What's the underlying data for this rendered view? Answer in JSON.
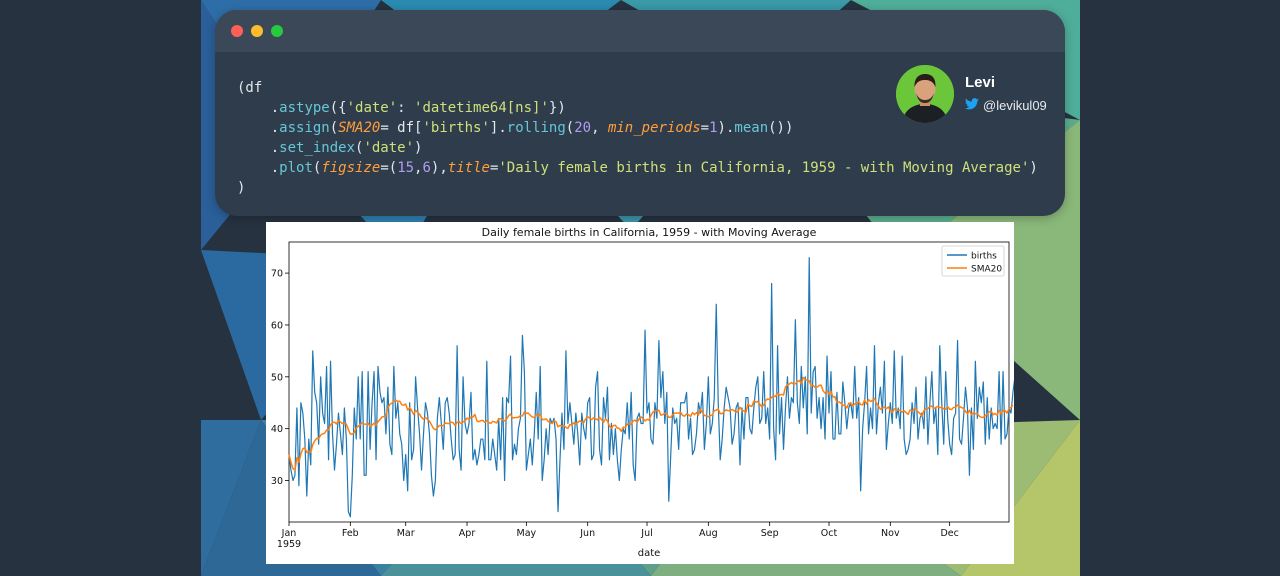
{
  "code": {
    "lines": [
      [
        {
          "t": "(df",
          "c": ""
        }
      ],
      [
        {
          "t": "    .",
          "c": ""
        },
        {
          "t": "astype",
          "c": "c-m"
        },
        {
          "t": "({",
          "c": ""
        },
        {
          "t": "'date'",
          "c": "c-s"
        },
        {
          "t": ": ",
          "c": ""
        },
        {
          "t": "'datetime64[ns]'",
          "c": "c-s"
        },
        {
          "t": "})",
          "c": ""
        }
      ],
      [
        {
          "t": "    .",
          "c": ""
        },
        {
          "t": "assign",
          "c": "c-m"
        },
        {
          "t": "(",
          "c": ""
        },
        {
          "t": "SMA20",
          "c": "c-k"
        },
        {
          "t": "= df[",
          "c": ""
        },
        {
          "t": "'births'",
          "c": "c-s"
        },
        {
          "t": "].",
          "c": ""
        },
        {
          "t": "rolling",
          "c": "c-m"
        },
        {
          "t": "(",
          "c": ""
        },
        {
          "t": "20",
          "c": "c-n"
        },
        {
          "t": ", ",
          "c": ""
        },
        {
          "t": "min_periods",
          "c": "c-k"
        },
        {
          "t": "=",
          "c": ""
        },
        {
          "t": "1",
          "c": "c-n"
        },
        {
          "t": ").",
          "c": ""
        },
        {
          "t": "mean",
          "c": "c-m"
        },
        {
          "t": "())",
          "c": ""
        }
      ],
      [
        {
          "t": "    .",
          "c": ""
        },
        {
          "t": "set_index",
          "c": "c-m"
        },
        {
          "t": "(",
          "c": ""
        },
        {
          "t": "'date'",
          "c": "c-s"
        },
        {
          "t": ")",
          "c": ""
        }
      ],
      [
        {
          "t": "    .",
          "c": ""
        },
        {
          "t": "plot",
          "c": "c-m"
        },
        {
          "t": "(",
          "c": ""
        },
        {
          "t": "figsize",
          "c": "c-k"
        },
        {
          "t": "=(",
          "c": ""
        },
        {
          "t": "15",
          "c": "c-n"
        },
        {
          "t": ",",
          "c": ""
        },
        {
          "t": "6",
          "c": "c-n"
        },
        {
          "t": "),",
          "c": ""
        },
        {
          "t": "title",
          "c": "c-k"
        },
        {
          "t": "=",
          "c": ""
        },
        {
          "t": "'Daily female births in California, 1959 - with Moving Average'",
          "c": "c-s"
        },
        {
          "t": ")",
          "c": ""
        }
      ],
      [
        {
          "t": ")",
          "c": ""
        }
      ]
    ]
  },
  "author": {
    "name": "Levi",
    "handle": "@levikul09",
    "icon": "twitter-bird-icon"
  },
  "window": {
    "buttons": [
      "close-dot",
      "minimize-dot",
      "maximize-dot"
    ]
  },
  "colors": {
    "births": "#1f77b4",
    "sma": "#ff7f0e",
    "twitter": "#1da1f2"
  },
  "chart_data": {
    "type": "line",
    "title": "Daily female births in California, 1959 - with Moving Average",
    "xlabel": "date",
    "ylabel": "",
    "ylim": [
      22,
      76
    ],
    "yticks": [
      30,
      40,
      50,
      60,
      70
    ],
    "xlim": [
      "1959-01-01",
      "1959-12-31"
    ],
    "xticks": [
      {
        "date": "1959-01-01",
        "label": "Jan",
        "sub": "1959"
      },
      {
        "date": "1959-02-01",
        "label": "Feb"
      },
      {
        "date": "1959-03-01",
        "label": "Mar"
      },
      {
        "date": "1959-04-01",
        "label": "Apr"
      },
      {
        "date": "1959-05-01",
        "label": "May"
      },
      {
        "date": "1959-06-01",
        "label": "Jun"
      },
      {
        "date": "1959-07-01",
        "label": "Jul"
      },
      {
        "date": "1959-08-01",
        "label": "Aug"
      },
      {
        "date": "1959-09-01",
        "label": "Sep"
      },
      {
        "date": "1959-10-01",
        "label": "Oct"
      },
      {
        "date": "1959-11-01",
        "label": "Nov"
      },
      {
        "date": "1959-12-01",
        "label": "Dec"
      }
    ],
    "legend": "top-right",
    "grid": false,
    "series": [
      {
        "name": "births",
        "color": "#1f77b4",
        "start_date": "1959-01-01",
        "values": [
          35,
          32,
          30,
          31,
          44,
          29,
          45,
          43,
          38,
          27,
          38,
          33,
          55,
          47,
          45,
          37,
          50,
          43,
          41,
          52,
          34,
          53,
          39,
          32,
          37,
          43,
          39,
          35,
          44,
          38,
          24,
          23,
          31,
          44,
          38,
          50,
          38,
          51,
          31,
          31,
          51,
          36,
          45,
          51,
          34,
          52,
          47,
          45,
          46,
          39,
          48,
          37,
          35,
          52,
          42,
          45,
          39,
          37,
          30,
          35,
          28,
          45,
          34,
          36,
          50,
          44,
          39,
          32,
          39,
          45,
          43,
          39,
          31,
          27,
          30,
          42,
          46,
          41,
          36,
          45,
          46,
          43,
          38,
          34,
          35,
          56,
          36,
          32,
          50,
          41,
          39,
          41,
          47,
          34,
          36,
          33,
          35,
          38,
          38,
          34,
          53,
          34,
          34,
          38,
          35,
          32,
          42,
          34,
          46,
          30,
          46,
          45,
          54,
          34,
          37,
          35,
          40,
          42,
          58,
          51,
          32,
          35,
          38,
          33,
          39,
          47,
          38,
          52,
          30,
          34,
          40,
          35,
          42,
          41,
          42,
          38,
          24,
          34,
          43,
          36,
          55,
          41,
          45,
          41,
          37,
          43,
          39,
          33,
          43,
          40,
          38,
          45,
          46,
          34,
          35,
          48,
          51,
          36,
          33,
          46,
          42,
          48,
          34,
          41,
          35,
          40,
          34,
          30,
          36,
          40,
          39,
          45,
          38,
          47,
          33,
          30,
          42,
          43,
          41,
          41,
          59,
          43,
          45,
          38,
          37,
          45,
          42,
          57,
          46,
          51,
          41,
          47,
          26,
          35,
          44,
          41,
          42,
          36,
          45,
          45,
          45,
          47,
          38,
          42,
          35,
          36,
          39,
          45,
          43,
          47,
          36,
          41,
          50,
          39,
          41,
          46,
          64,
          45,
          34,
          38,
          44,
          48,
          46,
          44,
          37,
          39,
          44,
          45,
          33,
          44,
          38,
          46,
          46,
          40,
          39,
          44,
          48,
          50,
          41,
          42,
          51,
          41,
          44,
          38,
          68,
          40,
          34,
          56,
          39,
          46,
          36,
          44,
          50,
          42,
          46,
          45,
          61,
          45,
          41,
          52,
          44,
          50,
          39,
          73,
          43,
          51,
          52,
          42,
          46,
          40,
          46,
          38,
          54,
          43,
          51,
          38,
          38,
          47,
          39,
          39,
          49,
          45,
          40,
          44,
          45,
          42,
          52,
          42,
          46,
          28,
          40,
          45,
          52,
          39,
          44,
          40,
          56,
          39,
          45,
          48,
          43,
          53,
          36,
          41,
          45,
          41,
          55,
          42,
          44,
          40,
          54,
          38,
          35,
          36,
          38,
          45,
          41,
          48,
          38,
          42,
          43,
          40,
          50,
          37,
          45,
          51,
          41,
          44,
          35,
          56,
          45,
          37,
          51,
          42,
          37,
          35,
          42,
          43,
          57,
          38,
          37,
          42,
          48,
          44,
          31,
          44,
          36,
          53,
          42,
          48,
          45,
          49,
          37,
          46,
          38,
          44,
          40,
          41,
          40,
          51,
          37,
          51,
          38,
          39,
          44,
          43,
          47,
          50,
          49,
          34,
          52,
          41,
          55,
          37,
          42,
          53
        ]
      },
      {
        "name": "SMA20",
        "color": "#ff7f0e",
        "values": [
          35.0,
          33.5,
          32.33,
          32.0,
          34.4,
          33.5,
          35.14,
          36.12,
          36.33,
          35.4,
          35.64,
          35.42,
          36.92,
          37.64,
          38.13,
          38.06,
          38.76,
          39.0,
          39.11,
          39.75,
          39.7,
          40.75,
          41.2,
          41.25,
          40.9,
          41.6,
          41.3,
          41.0,
          41.0,
          40.9,
          39.85,
          38.95,
          38.95,
          39.25,
          40.15,
          40.45,
          40.8,
          41.1,
          40.9,
          40.85,
          41.05,
          40.4,
          40.7,
          41.05,
          40.65,
          41.35,
          41.75,
          42.25,
          42.35,
          42.4,
          44.0,
          44.7,
          44.9,
          45.3,
          45.5,
          45.25,
          45.3,
          44.6,
          44.55,
          44.75,
          43.6,
          44.05,
          43.5,
          42.75,
          43.55,
          43.15,
          42.8,
          42.15,
          41.85,
          42.15,
          41.8,
          41.45,
          40.75,
          40.05,
          39.8,
          40.15,
          40.6,
          40.55,
          40.6,
          41.1,
          41.0,
          41.0,
          41.25,
          41.15,
          40.6,
          41.25,
          41.35,
          41.0,
          41.3,
          41.5,
          42.05,
          41.8,
          42.25,
          42.25,
          42.75,
          41.5,
          41.35,
          41.55,
          41.6,
          41.2,
          41.55,
          41.2,
          41.0,
          41.4,
          41.3,
          41.1,
          41.9,
          41.9,
          41.7,
          41.5,
          41.85,
          42.5,
          42.8,
          42.05,
          42.1,
          42.15,
          42.2,
          42.5,
          42.45,
          43.2,
          42.95,
          43.0,
          42.55,
          42.25,
          42.15,
          42.75,
          42.45,
          42.7,
          41.75,
          41.75,
          41.9,
          41.4,
          41.2,
          41.0,
          41.45,
          41.35,
          40.35,
          40.65,
          40.5,
          40.6,
          40.25,
          40.05,
          40.8,
          40.65,
          41.15,
          40.9,
          41.2,
          41.5,
          41.3,
          41.15,
          41.9,
          42.3,
          42.05,
          41.75,
          42.1,
          41.9,
          41.7,
          42.2,
          41.75,
          41.2,
          41.9,
          41.5,
          40.5,
          40.1,
          40.6,
          40.65,
          40.1,
          40.05,
          39.5,
          40.3,
          40.2,
          40.85,
          40.95,
          40.85,
          41.5,
          41.65,
          41.2,
          41.9,
          42.25,
          41.95,
          41.5,
          41.8,
          41.65,
          42.6,
          43.2,
          43.5,
          43.45,
          43.55,
          42.6,
          42.7,
          43.0,
          42.8,
          42.2,
          42.2,
          42.7,
          43.0,
          43.0,
          43.0,
          43.15,
          42.55,
          42.4,
          42.85,
          42.7,
          42.35,
          43.1,
          42.7,
          43.1,
          42.6,
          43.8,
          43.1,
          42.55,
          42.45,
          42.3,
          42.55,
          42.6,
          43.5,
          43.55,
          43.8,
          42.9,
          42.9,
          43.3,
          43.65,
          43.45,
          43.5,
          43.7,
          43.5,
          43.15,
          43.35,
          44.15,
          43.55,
          43.45,
          43.1,
          44.75,
          44.4,
          44.3,
          45.3,
          45.1,
          45.25,
          44.75,
          44.2,
          44.55,
          45.45,
          45.75,
          45.6,
          46.05,
          46.3,
          46.2,
          46.9,
          46.45,
          46.6,
          46.5,
          48.05,
          48.45,
          48.6,
          48.9,
          48.6,
          48.65,
          49.05,
          49.3,
          48.7,
          49.85,
          49.5,
          49.35,
          49.2,
          48.25,
          48.35,
          47.95,
          48.0,
          48.35,
          48.4,
          47.3,
          46.85,
          47.25,
          46.65,
          47.2,
          46.1,
          46.15,
          45.05,
          45.15,
          44.95,
          44.5,
          44.55,
          44.0,
          44.9,
          44.95,
          44.35,
          44.8,
          44.95,
          45.2,
          44.65,
          44.6,
          45.55,
          44.75,
          45.6,
          45.25,
          45.45,
          45.85,
          44.9,
          44.35,
          43.75,
          43.95,
          44.15,
          43.85,
          44.2,
          43.45,
          43.1,
          43.8,
          43.6,
          43.55,
          43.55,
          43.2,
          43.45,
          43.1,
          42.75,
          43.6,
          43.35,
          43.75,
          43.8,
          43.25,
          42.95,
          42.35,
          43.5,
          43.85,
          43.85,
          44.3,
          44.35,
          43.9,
          44.1,
          44.3,
          44.05,
          44.2,
          43.8,
          43.75,
          44.25,
          43.75,
          43.7,
          44.1,
          44.1,
          44.55,
          44.25,
          44.1,
          43.9,
          43.35,
          42.85,
          43.55,
          42.7,
          43.0,
          42.9,
          42.9,
          42.4,
          42.2,
          42.15,
          42.5,
          42.85,
          43.25,
          43.35,
          42.7,
          42.95,
          42.6,
          43.5,
          42.85,
          43.5,
          43.5,
          43.0,
          43.85,
          44.1,
          44.55
        ]
      }
    ]
  }
}
